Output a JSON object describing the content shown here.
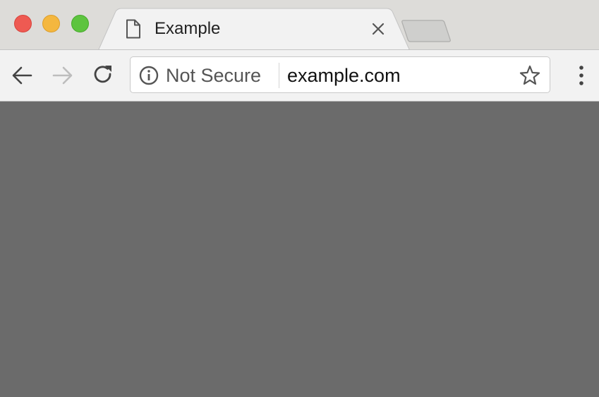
{
  "tab": {
    "title": "Example",
    "icon": "page-icon",
    "close_icon": "close-icon"
  },
  "window_controls": [
    "close",
    "minimize",
    "maximize"
  ],
  "toolbar": {
    "back_icon": "back-arrow-icon",
    "forward_icon": "forward-arrow-icon",
    "reload_icon": "reload-icon",
    "menu_icon": "more-vertical-icon"
  },
  "omnibox": {
    "security_icon": "info-icon",
    "security_label": "Not Secure",
    "url": "example.com",
    "bookmark_icon": "star-icon"
  },
  "colors": {
    "content_background": "#6b6b6b",
    "tabstrip_background": "#dddcd9",
    "toolbar_background": "#f2f2f2"
  }
}
